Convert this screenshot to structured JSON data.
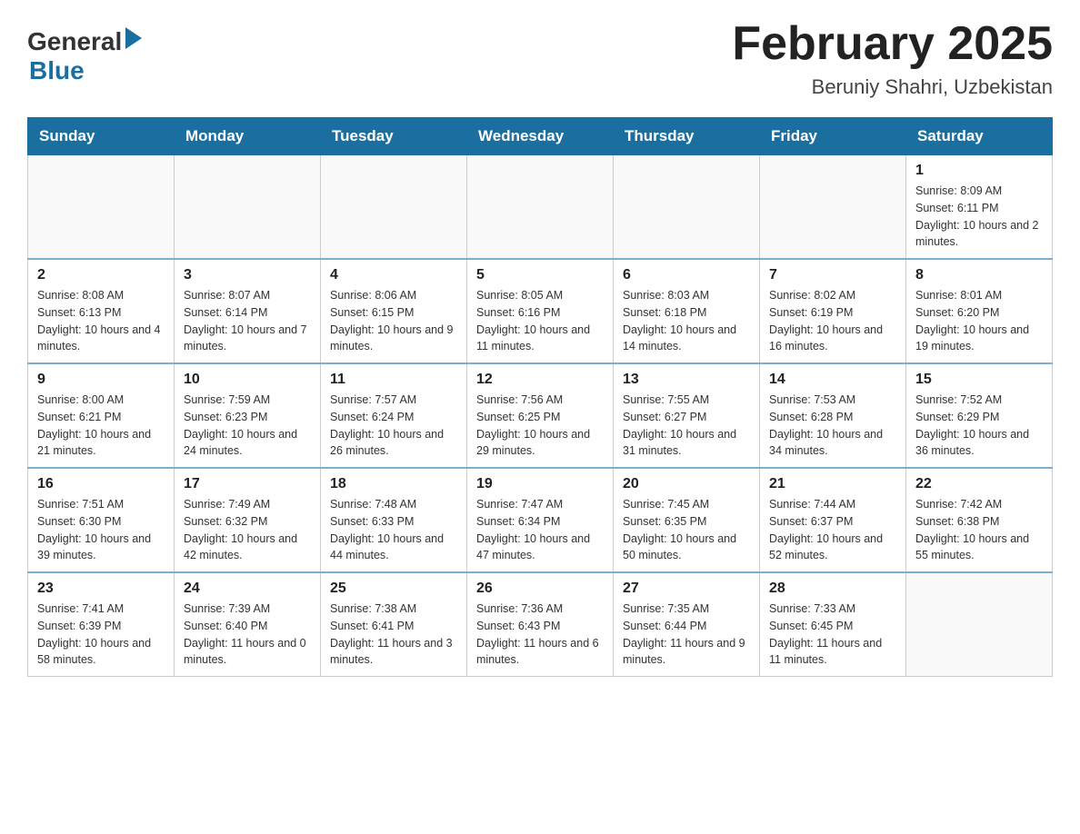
{
  "header": {
    "logo_general": "General",
    "logo_blue": "Blue",
    "title": "February 2025",
    "subtitle": "Beruniy Shahri, Uzbekistan"
  },
  "weekdays": [
    "Sunday",
    "Monday",
    "Tuesday",
    "Wednesday",
    "Thursday",
    "Friday",
    "Saturday"
  ],
  "weeks": [
    [
      {
        "day": "",
        "info": ""
      },
      {
        "day": "",
        "info": ""
      },
      {
        "day": "",
        "info": ""
      },
      {
        "day": "",
        "info": ""
      },
      {
        "day": "",
        "info": ""
      },
      {
        "day": "",
        "info": ""
      },
      {
        "day": "1",
        "info": "Sunrise: 8:09 AM\nSunset: 6:11 PM\nDaylight: 10 hours and 2 minutes."
      }
    ],
    [
      {
        "day": "2",
        "info": "Sunrise: 8:08 AM\nSunset: 6:13 PM\nDaylight: 10 hours and 4 minutes."
      },
      {
        "day": "3",
        "info": "Sunrise: 8:07 AM\nSunset: 6:14 PM\nDaylight: 10 hours and 7 minutes."
      },
      {
        "day": "4",
        "info": "Sunrise: 8:06 AM\nSunset: 6:15 PM\nDaylight: 10 hours and 9 minutes."
      },
      {
        "day": "5",
        "info": "Sunrise: 8:05 AM\nSunset: 6:16 PM\nDaylight: 10 hours and 11 minutes."
      },
      {
        "day": "6",
        "info": "Sunrise: 8:03 AM\nSunset: 6:18 PM\nDaylight: 10 hours and 14 minutes."
      },
      {
        "day": "7",
        "info": "Sunrise: 8:02 AM\nSunset: 6:19 PM\nDaylight: 10 hours and 16 minutes."
      },
      {
        "day": "8",
        "info": "Sunrise: 8:01 AM\nSunset: 6:20 PM\nDaylight: 10 hours and 19 minutes."
      }
    ],
    [
      {
        "day": "9",
        "info": "Sunrise: 8:00 AM\nSunset: 6:21 PM\nDaylight: 10 hours and 21 minutes."
      },
      {
        "day": "10",
        "info": "Sunrise: 7:59 AM\nSunset: 6:23 PM\nDaylight: 10 hours and 24 minutes."
      },
      {
        "day": "11",
        "info": "Sunrise: 7:57 AM\nSunset: 6:24 PM\nDaylight: 10 hours and 26 minutes."
      },
      {
        "day": "12",
        "info": "Sunrise: 7:56 AM\nSunset: 6:25 PM\nDaylight: 10 hours and 29 minutes."
      },
      {
        "day": "13",
        "info": "Sunrise: 7:55 AM\nSunset: 6:27 PM\nDaylight: 10 hours and 31 minutes."
      },
      {
        "day": "14",
        "info": "Sunrise: 7:53 AM\nSunset: 6:28 PM\nDaylight: 10 hours and 34 minutes."
      },
      {
        "day": "15",
        "info": "Sunrise: 7:52 AM\nSunset: 6:29 PM\nDaylight: 10 hours and 36 minutes."
      }
    ],
    [
      {
        "day": "16",
        "info": "Sunrise: 7:51 AM\nSunset: 6:30 PM\nDaylight: 10 hours and 39 minutes."
      },
      {
        "day": "17",
        "info": "Sunrise: 7:49 AM\nSunset: 6:32 PM\nDaylight: 10 hours and 42 minutes."
      },
      {
        "day": "18",
        "info": "Sunrise: 7:48 AM\nSunset: 6:33 PM\nDaylight: 10 hours and 44 minutes."
      },
      {
        "day": "19",
        "info": "Sunrise: 7:47 AM\nSunset: 6:34 PM\nDaylight: 10 hours and 47 minutes."
      },
      {
        "day": "20",
        "info": "Sunrise: 7:45 AM\nSunset: 6:35 PM\nDaylight: 10 hours and 50 minutes."
      },
      {
        "day": "21",
        "info": "Sunrise: 7:44 AM\nSunset: 6:37 PM\nDaylight: 10 hours and 52 minutes."
      },
      {
        "day": "22",
        "info": "Sunrise: 7:42 AM\nSunset: 6:38 PM\nDaylight: 10 hours and 55 minutes."
      }
    ],
    [
      {
        "day": "23",
        "info": "Sunrise: 7:41 AM\nSunset: 6:39 PM\nDaylight: 10 hours and 58 minutes."
      },
      {
        "day": "24",
        "info": "Sunrise: 7:39 AM\nSunset: 6:40 PM\nDaylight: 11 hours and 0 minutes."
      },
      {
        "day": "25",
        "info": "Sunrise: 7:38 AM\nSunset: 6:41 PM\nDaylight: 11 hours and 3 minutes."
      },
      {
        "day": "26",
        "info": "Sunrise: 7:36 AM\nSunset: 6:43 PM\nDaylight: 11 hours and 6 minutes."
      },
      {
        "day": "27",
        "info": "Sunrise: 7:35 AM\nSunset: 6:44 PM\nDaylight: 11 hours and 9 minutes."
      },
      {
        "day": "28",
        "info": "Sunrise: 7:33 AM\nSunset: 6:45 PM\nDaylight: 11 hours and 11 minutes."
      },
      {
        "day": "",
        "info": ""
      }
    ]
  ]
}
